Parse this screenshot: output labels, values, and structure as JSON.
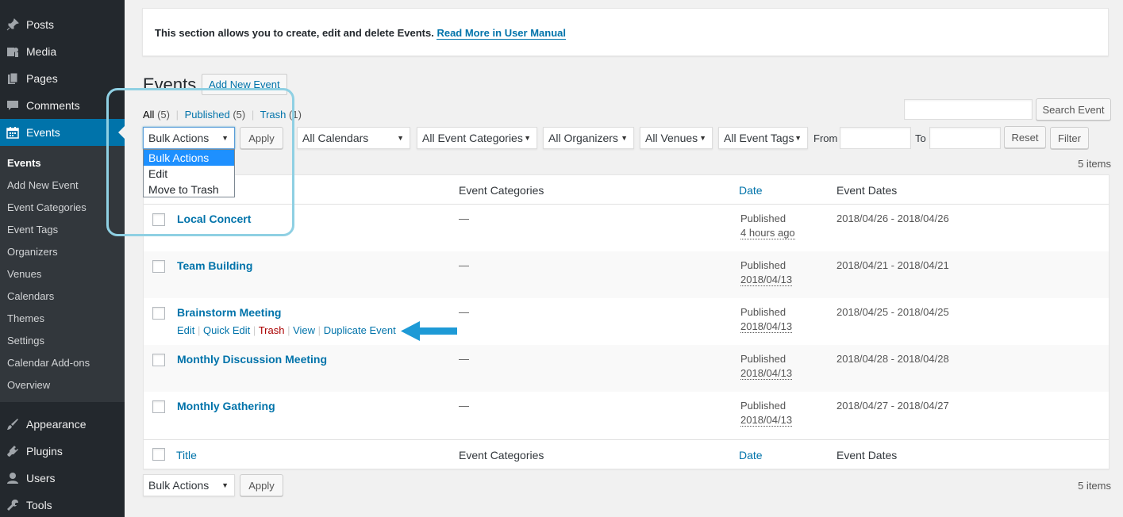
{
  "sidebar": {
    "top_items": [
      {
        "label": "Posts",
        "icon": "pin-icon"
      },
      {
        "label": "Media",
        "icon": "media-icon"
      },
      {
        "label": "Pages",
        "icon": "pages-icon"
      },
      {
        "label": "Comments",
        "icon": "comment-icon"
      },
      {
        "label": "Events",
        "icon": "calendar-icon"
      }
    ],
    "submenu": [
      "Events",
      "Add New Event",
      "Event Categories",
      "Event Tags",
      "Organizers",
      "Venues",
      "Calendars",
      "Themes",
      "Settings",
      "Calendar Add-ons",
      "Overview"
    ],
    "bottom_items": [
      {
        "label": "Appearance",
        "icon": "brush-icon"
      },
      {
        "label": "Plugins",
        "icon": "plugin-icon"
      },
      {
        "label": "Users",
        "icon": "user-icon"
      },
      {
        "label": "Tools",
        "icon": "wrench-icon"
      }
    ]
  },
  "notice": {
    "text": "This section allows you to create, edit and delete Events.",
    "link": "Read More in User Manual"
  },
  "header": {
    "title": "Events",
    "add_new": "Add New Event"
  },
  "status_links": {
    "all": "All",
    "all_count": "(5)",
    "published": "Published",
    "published_count": "(5)",
    "trash": "Trash",
    "trash_count": "(1)",
    "sep": "|"
  },
  "search": {
    "button": "Search Event"
  },
  "filters": {
    "bulk_actions": "Bulk Actions",
    "apply": "Apply",
    "calendars": "All Calendars",
    "categories": "All Event Categories",
    "organizers": "All Organizers",
    "venues": "All Venues",
    "tags": "All Event Tags",
    "from": "From",
    "to": "To",
    "reset": "Reset",
    "filter": "Filter"
  },
  "bulk_options": [
    "Bulk Actions",
    "Edit",
    "Move to Trash"
  ],
  "items_count": "5 items",
  "table": {
    "columns": {
      "title": "Title",
      "categories": "Event Categories",
      "date": "Date",
      "dates": "Event Dates"
    },
    "rows": [
      {
        "title": "Local Concert",
        "category": "—",
        "status": "Published",
        "when": "4 hours ago",
        "dates": "2018/04/26 - 2018/04/26"
      },
      {
        "title": "Team Building",
        "category": "—",
        "status": "Published",
        "when": "2018/04/13",
        "dates": "2018/04/21 - 2018/04/21"
      },
      {
        "title": "Brainstorm Meeting",
        "category": "—",
        "status": "Published",
        "when": "2018/04/13",
        "dates": "2018/04/25 - 2018/04/25"
      },
      {
        "title": "Monthly Discussion Meeting",
        "category": "—",
        "status": "Published",
        "when": "2018/04/13",
        "dates": "2018/04/28 - 2018/04/28"
      },
      {
        "title": "Monthly Gathering",
        "category": "—",
        "status": "Published",
        "when": "2018/04/13",
        "dates": "2018/04/27 - 2018/04/27"
      }
    ],
    "row_actions": {
      "edit": "Edit",
      "quick_edit": "Quick Edit",
      "trash": "Trash",
      "view": "View",
      "duplicate": "Duplicate Event",
      "sep": "|"
    }
  },
  "colors": {
    "accent": "#0073aa",
    "sidebar_bg": "#23282d",
    "highlight": "#8fd0e3",
    "arrow": "#1e9ad6"
  }
}
